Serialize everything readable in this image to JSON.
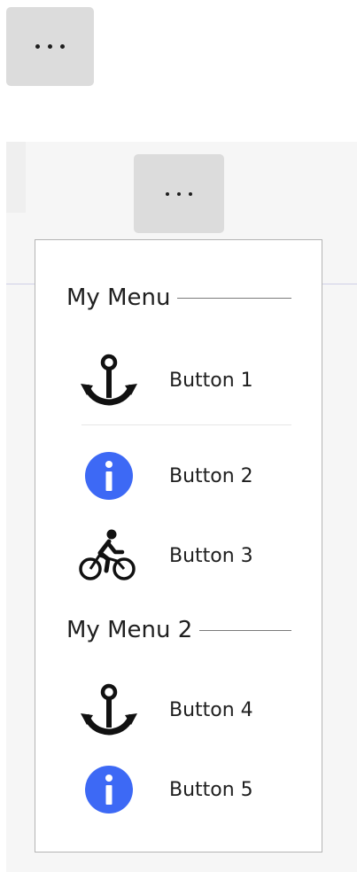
{
  "toolbar": {
    "more_icon": "ellipsis-icon"
  },
  "panel": {
    "more_icon": "ellipsis-icon"
  },
  "menu": {
    "sections": [
      {
        "title": "My Menu"
      },
      {
        "title": "My Menu 2"
      }
    ],
    "items": [
      {
        "label": "Button 1",
        "icon": "anchor-icon"
      },
      {
        "label": "Button 2",
        "icon": "info-icon"
      },
      {
        "label": "Button 3",
        "icon": "bicycle-icon"
      },
      {
        "label": "Button 4",
        "icon": "anchor-icon"
      },
      {
        "label": "Button 5",
        "icon": "info-icon"
      }
    ]
  },
  "colors": {
    "button_bg": "#dcdcdc",
    "panel_bg": "#f6f6f6",
    "info_blue": "#3d69f5",
    "menu_border": "#b4b4b4"
  }
}
